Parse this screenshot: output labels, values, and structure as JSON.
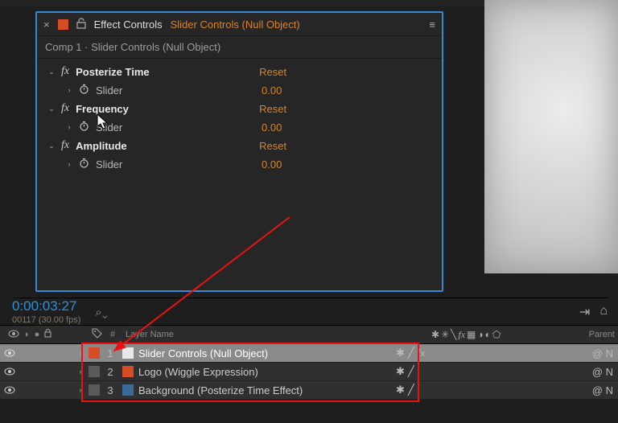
{
  "panel": {
    "tab_static": "Effect Controls",
    "tab_dynamic": "Slider Controls (Null Object)",
    "close_x": "×",
    "menu_glyph": "≡",
    "subtitle": "Comp 1 · Slider Controls (Null Object)"
  },
  "effects": [
    {
      "name": "Posterize Time",
      "reset": "Reset",
      "slider_label": "Slider",
      "slider_value": "0.00"
    },
    {
      "name": "Frequency",
      "reset": "Reset",
      "slider_label": "Slider",
      "slider_value": "0.00"
    },
    {
      "name": "Amplitude",
      "reset": "Reset",
      "slider_label": "Slider",
      "slider_value": "0.00"
    }
  ],
  "timeline": {
    "timecode": "0:00:03:27",
    "fps": "00117 (30.00 fps)",
    "search_glyph": "⌕⌄"
  },
  "layer_header": {
    "hash": "#",
    "layer_name": "Layer Name",
    "parent": "Parent"
  },
  "layers": [
    {
      "color": "#d84b27",
      "index": "1",
      "icon_bg": "#e8e8e8",
      "name": "Slider Controls (Null Object)",
      "fx": "fx",
      "selected": true
    },
    {
      "color": "#5a5a5a",
      "index": "2",
      "icon_bg": "#d84b27",
      "name": "Logo (Wiggle Expression)",
      "fx": "",
      "selected": false
    },
    {
      "color": "#5a5a5a",
      "index": "3",
      "icon_bg": "#3a6a9a",
      "name": "Background (Posterize Time Effect)",
      "fx": "",
      "selected": false
    }
  ],
  "glyph": {
    "twirl_open": "⌄",
    "twirl_closed": "›",
    "stopwatch": "Ö",
    "lock": "⎆",
    "eye": "◉",
    "tag": "🏷",
    "sun": "☀",
    "cube": "◍",
    "none": "N"
  }
}
